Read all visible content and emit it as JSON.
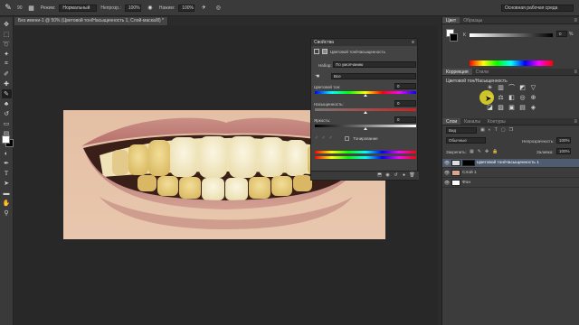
{
  "document": {
    "tab_title": "Без имени-1 @ 50% (Цветовой тон/Насыщенность 1, Слой-маска/8) *"
  },
  "options_bar": {
    "size_value": "90",
    "mode_label": "Режим:",
    "mode_value": "Нормальный",
    "opacity_label": "Непрозр.:",
    "opacity_value": "100%",
    "flow_label": "Нажим:",
    "flow_value": "100%",
    "workspace": "Основная рабочая среда"
  },
  "colors": {
    "accent_selection": "#4f5c70",
    "cursor_highlight": "#e6dc28"
  },
  "properties_panel": {
    "header": "Свойства",
    "title": "Цветовой тон/Насыщенность",
    "preset_label": "Набор:",
    "preset_value": "По умолчанию",
    "channel_value": "Все",
    "hue_label": "Цветовой тон:",
    "hue_value": "0",
    "saturation_label": "Насыщенность:",
    "saturation_value": "0",
    "lightness_label": "Яркость:",
    "lightness_value": "0",
    "colorize_label": "Тонирование"
  },
  "color_panel": {
    "tabs": [
      "Цвет",
      "Образцы"
    ],
    "channel_label": "К",
    "value": "0",
    "percent": "%"
  },
  "adjustments_panel": {
    "tabs": [
      "Коррекция",
      "Стили"
    ],
    "title": "Цветовой тон/Насыщенность",
    "icons": [
      "brightness-icon",
      "levels-icon",
      "curves-icon",
      "exposure-icon",
      "vibrance-icon",
      "hue-sat-icon",
      "color-balance-icon",
      "bw-icon",
      "photo-filter-icon",
      "channel-mixer-icon",
      "invert-icon",
      "posterize-icon",
      "threshold-icon",
      "gradient-map-icon",
      "selective-color-icon"
    ]
  },
  "layers_panel": {
    "tabs": [
      "Слои",
      "Каналы",
      "Контуры"
    ],
    "kind_value": "Вид",
    "blend_value": "Обычные",
    "opacity_label": "Непрозрачность:",
    "opacity_value": "100%",
    "lock_label": "Закрепить:",
    "fill_label": "Заливка:",
    "fill_value": "100%",
    "layers": [
      {
        "name": "Цветовой тон/Насыщенность 1",
        "selected": true
      },
      {
        "name": "Слой 1",
        "selected": false
      },
      {
        "name": "Фон",
        "selected": false
      }
    ]
  }
}
